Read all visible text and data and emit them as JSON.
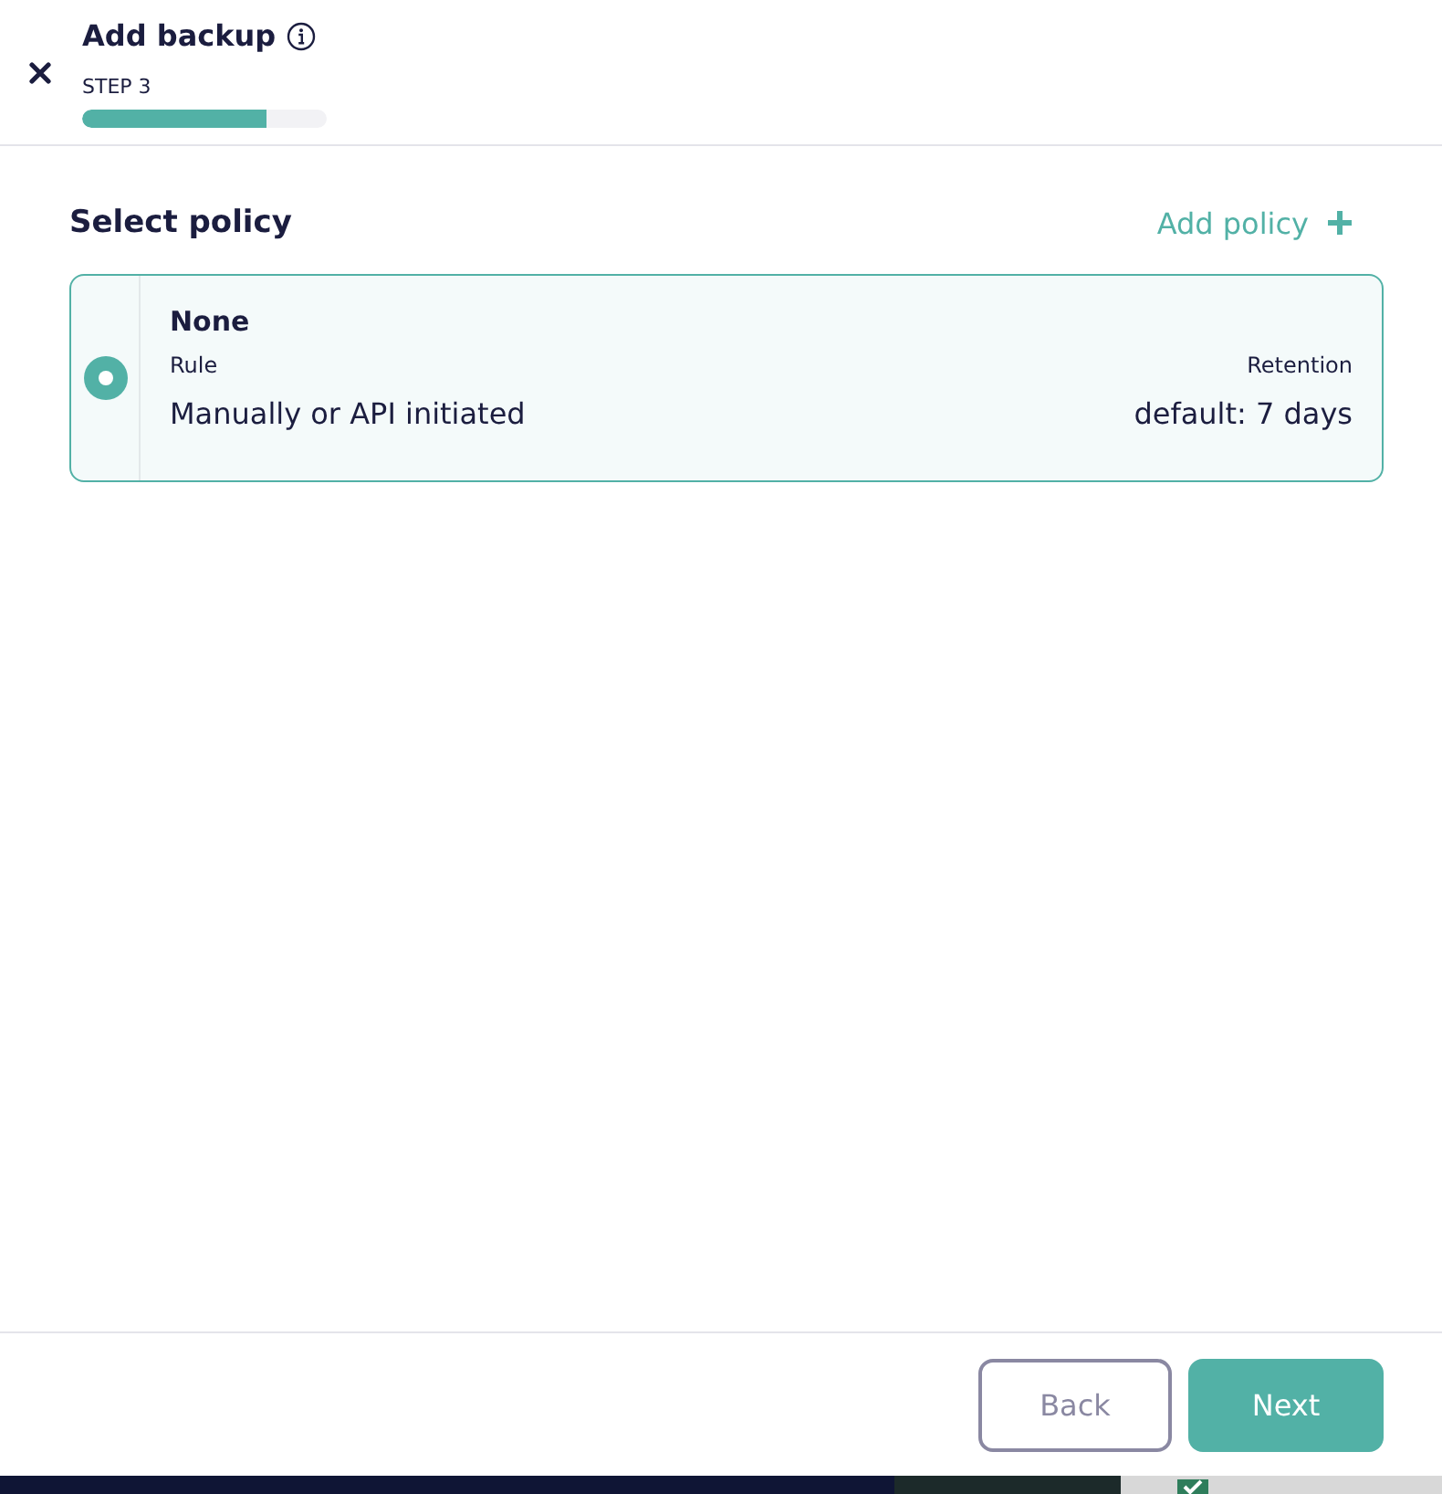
{
  "dialog": {
    "title": "Add backup",
    "step": "STEP 3",
    "progress": {
      "level": 0.75
    }
  },
  "section": {
    "title": "Select policy",
    "add_link": "Add policy"
  },
  "policies": [
    {
      "name": "None",
      "selected": true,
      "rule_label": "Rule",
      "rule": "Manually or API initiated",
      "retention_label": "Retention",
      "retention": "default: 7 days"
    }
  ],
  "buttons": [
    {
      "label": "Back",
      "kind": "secondary"
    },
    {
      "label": "Next",
      "kind": "primary"
    }
  ],
  "background_app": {
    "checkbox": {
      "checked": true
    }
  }
}
